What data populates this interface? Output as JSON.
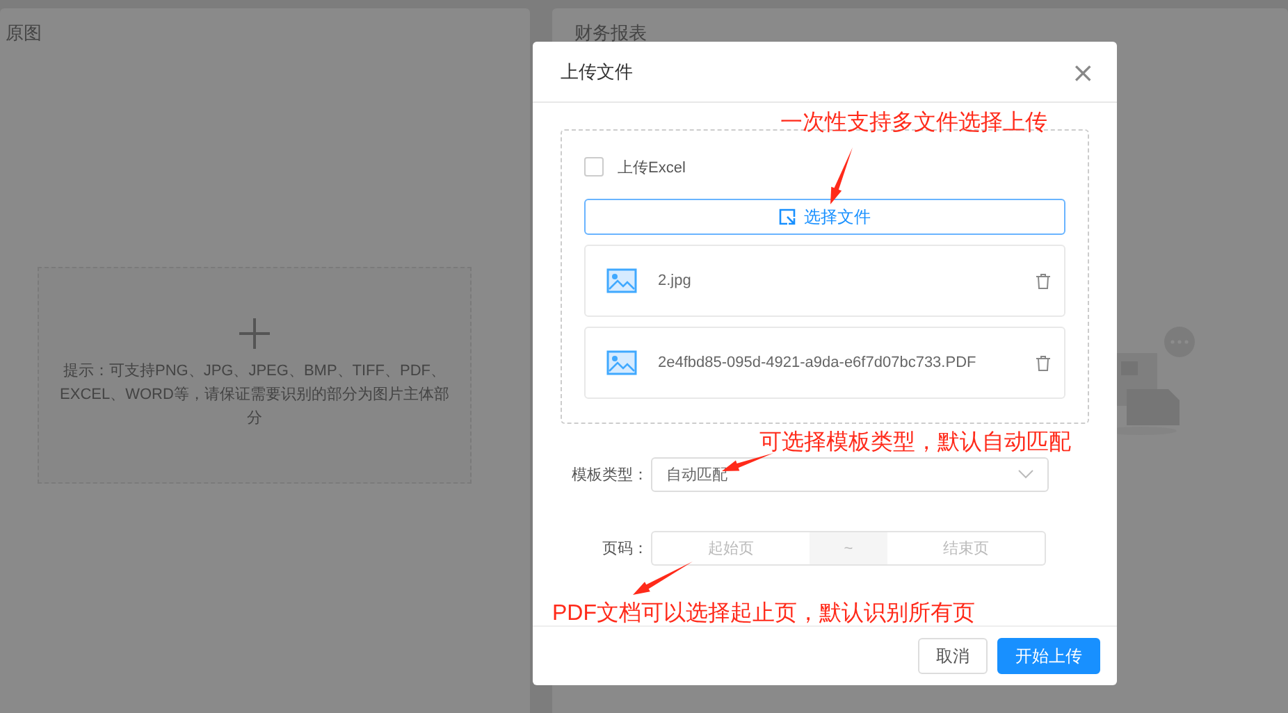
{
  "panels": [
    {
      "title": "原图"
    },
    {
      "title": "财务报表"
    }
  ],
  "upload_area": {
    "hint": "提示：可支持PNG、JPG、JPEG、BMP、TIFF、PDF、EXCEL、WORD等，请保证需要识别的部分为图片主体部分"
  },
  "dialog": {
    "title": "上传文件",
    "close": "×",
    "upload_excel": {
      "label": "上传Excel",
      "checked": false
    },
    "select_button": "选择文件",
    "files": [
      {
        "name": "2.jpg"
      },
      {
        "name": "2e4fbd85-095d-4921-a9da-e6f7d07bc733.PDF"
      }
    ],
    "template": {
      "label": "模板类型：",
      "value": "自动匹配"
    },
    "page_range": {
      "label": "页码：",
      "start_placeholder": "起始页",
      "separator": "~",
      "end_placeholder": "结束页"
    },
    "buttons": [
      {
        "label": "取消",
        "kind": "default"
      },
      {
        "label": "开始上传",
        "kind": "primary"
      }
    ]
  },
  "annotations": [
    {
      "text": "一次性支持多文件选择上传"
    },
    {
      "text": "可选择模板类型，默认自动匹配"
    },
    {
      "text": "PDF文档可以选择起止页，默认识别所有页"
    }
  ]
}
